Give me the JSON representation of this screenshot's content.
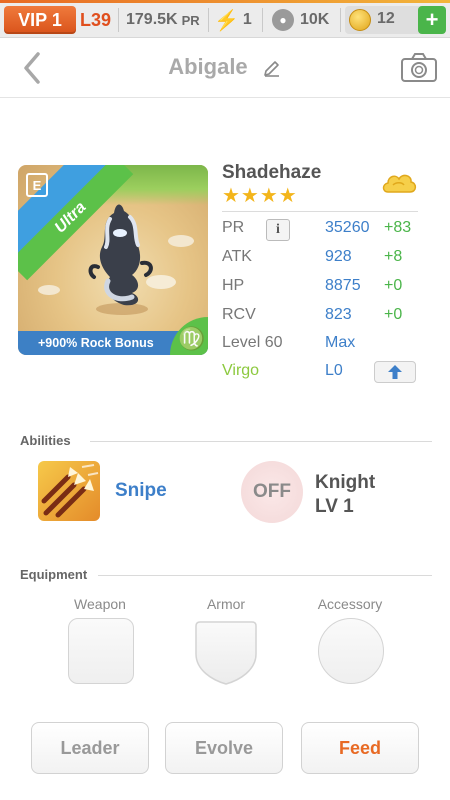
{
  "status_bar": {
    "vip_label": "VIP 1",
    "level": "L39",
    "power": "179.5K",
    "power_unit": "PR",
    "energy": "1",
    "food": "10K",
    "coins": "12",
    "add_label": "+"
  },
  "header": {
    "title": "Abigale"
  },
  "monster": {
    "name": "Shadehaze",
    "stars": "★★★★",
    "rarity": "Ultra",
    "element_badge": "E",
    "bonus": "+900% Rock Bonus",
    "zodiac_symbol": "♍",
    "stats": [
      {
        "label": "PR",
        "value": "35260",
        "delta": "+83"
      },
      {
        "label": "ATK",
        "value": "928",
        "delta": "+8"
      },
      {
        "label": "HP",
        "value": "8875",
        "delta": "+0"
      },
      {
        "label": "RCV",
        "value": "823",
        "delta": "+0"
      }
    ],
    "level_label": "Level 60",
    "level_value": "Max",
    "sign_label": "Virgo",
    "sign_level": "L0",
    "info_label": "i"
  },
  "abilities": {
    "section_title": "Abilities",
    "primary_name": "Snipe",
    "secondary_state": "OFF",
    "secondary_name": "Knight",
    "secondary_level": "LV 1"
  },
  "equipment": {
    "section_title": "Equipment",
    "weapon_label": "Weapon",
    "armor_label": "Armor",
    "accessory_label": "Accessory"
  },
  "actions": {
    "leader": "Leader",
    "evolve": "Evolve",
    "feed": "Feed"
  },
  "colors": {
    "accent_orange": "#e86a24",
    "stat_blue": "#3d7fc9",
    "delta_green": "#4bb54a",
    "star_gold": "#f3b51b"
  }
}
